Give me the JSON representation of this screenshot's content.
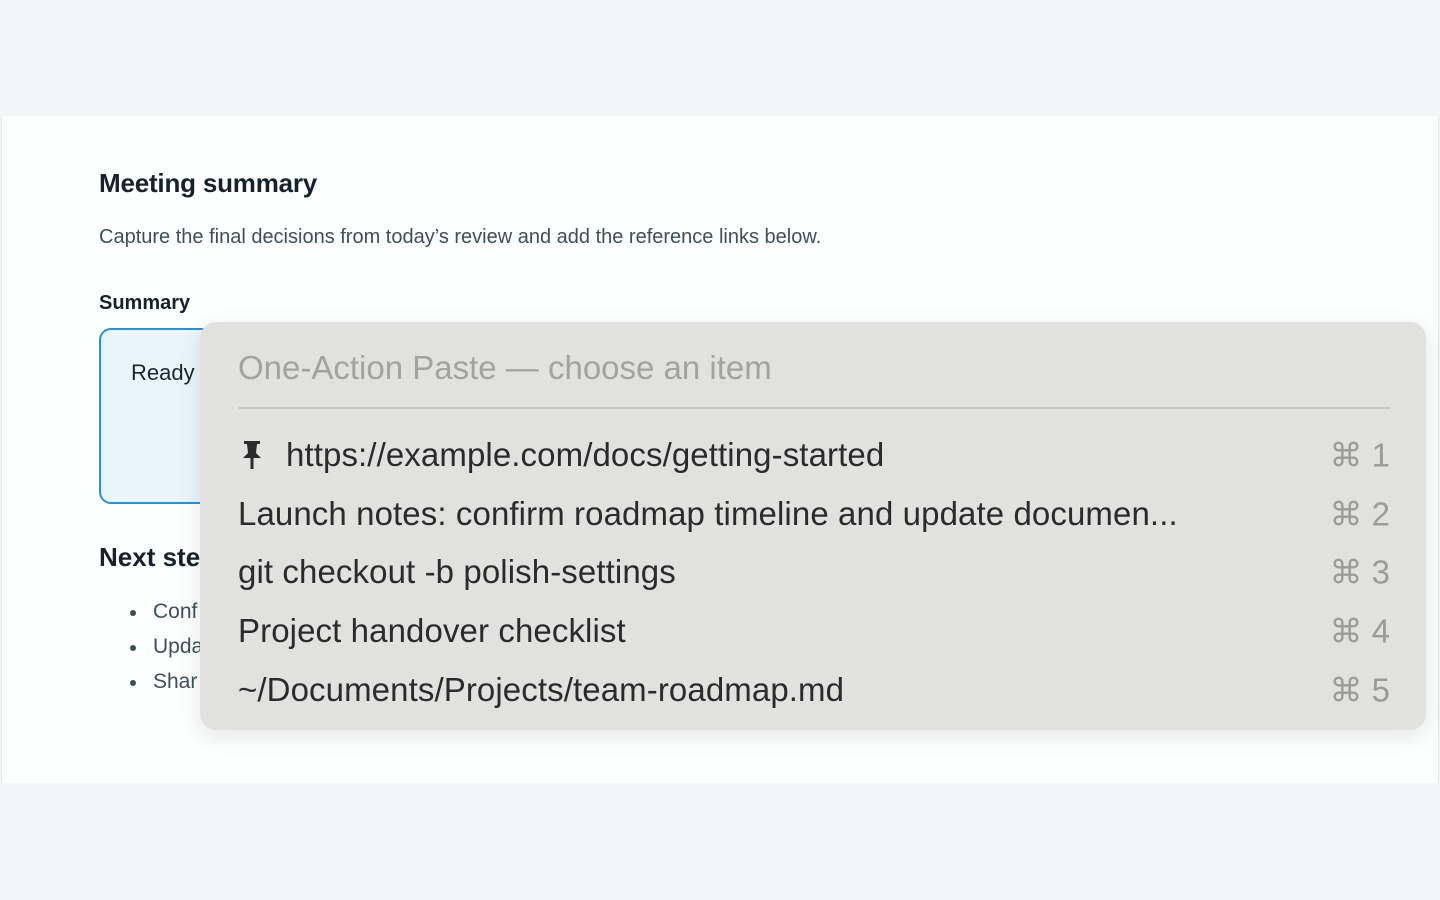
{
  "document": {
    "title": "Meeting summary",
    "subtitle": "Capture the final decisions from today’s review and add the reference links below.",
    "summary_label": "Summary",
    "summary_value": "Ready",
    "next_steps_title": "Next ste",
    "next_steps": [
      "Conf",
      "Upda",
      "Shar"
    ]
  },
  "paste_panel": {
    "search_placeholder": "One-Action Paste — choose an item",
    "items": [
      {
        "text": "https://example.com/docs/getting-started",
        "shortcut": "⌘ 1",
        "pinned": true,
        "icon": "pin-icon"
      },
      {
        "text": "Launch notes: confirm roadmap timeline and update documen...",
        "shortcut": "⌘ 2",
        "pinned": false
      },
      {
        "text": "git checkout -b polish-settings",
        "shortcut": "⌘ 3",
        "pinned": false
      },
      {
        "text": "Project handover checklist",
        "shortcut": "⌘ 4",
        "pinned": false
      },
      {
        "text": "~/Documents/Projects/team-roadmap.md",
        "shortcut": "⌘ 5",
        "pinned": false
      }
    ]
  },
  "colors": {
    "accent_border": "#2f8fd0",
    "input_fill": "#e9f4fb",
    "panel_bg": "#e1e2df"
  }
}
